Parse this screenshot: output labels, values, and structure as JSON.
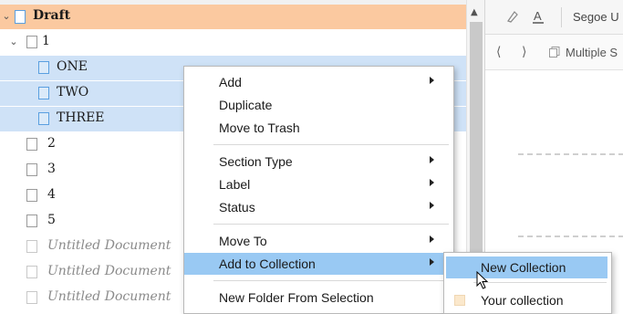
{
  "binder": {
    "items": [
      {
        "label": "Draft"
      },
      {
        "label": "1"
      },
      {
        "label": "ONE"
      },
      {
        "label": "TWO"
      },
      {
        "label": "THREE"
      },
      {
        "label": "2"
      },
      {
        "label": "3"
      },
      {
        "label": "4"
      },
      {
        "label": "5"
      },
      {
        "label": "Untitled Document"
      },
      {
        "label": "Untitled Document"
      },
      {
        "label": "Untitled Document"
      }
    ]
  },
  "editor": {
    "font_name": "Segoe U",
    "nav_label": "Multiple S"
  },
  "context_menu": {
    "items": [
      {
        "label": "Add"
      },
      {
        "label": "Duplicate"
      },
      {
        "label": "Move to Trash"
      },
      {
        "label": "Section Type"
      },
      {
        "label": "Label"
      },
      {
        "label": "Status"
      },
      {
        "label": "Move To"
      },
      {
        "label": "Add to Collection"
      },
      {
        "label": "New Folder From Selection"
      }
    ]
  },
  "submenu": {
    "items": [
      {
        "label": "New Collection"
      },
      {
        "label": "Your collection"
      }
    ]
  },
  "colors": {
    "root_row": "#fbc9a0",
    "selected_row": "#cfe2f7",
    "menu_highlight": "#99c9f3",
    "collection_swatch": "#fbe8cc"
  }
}
